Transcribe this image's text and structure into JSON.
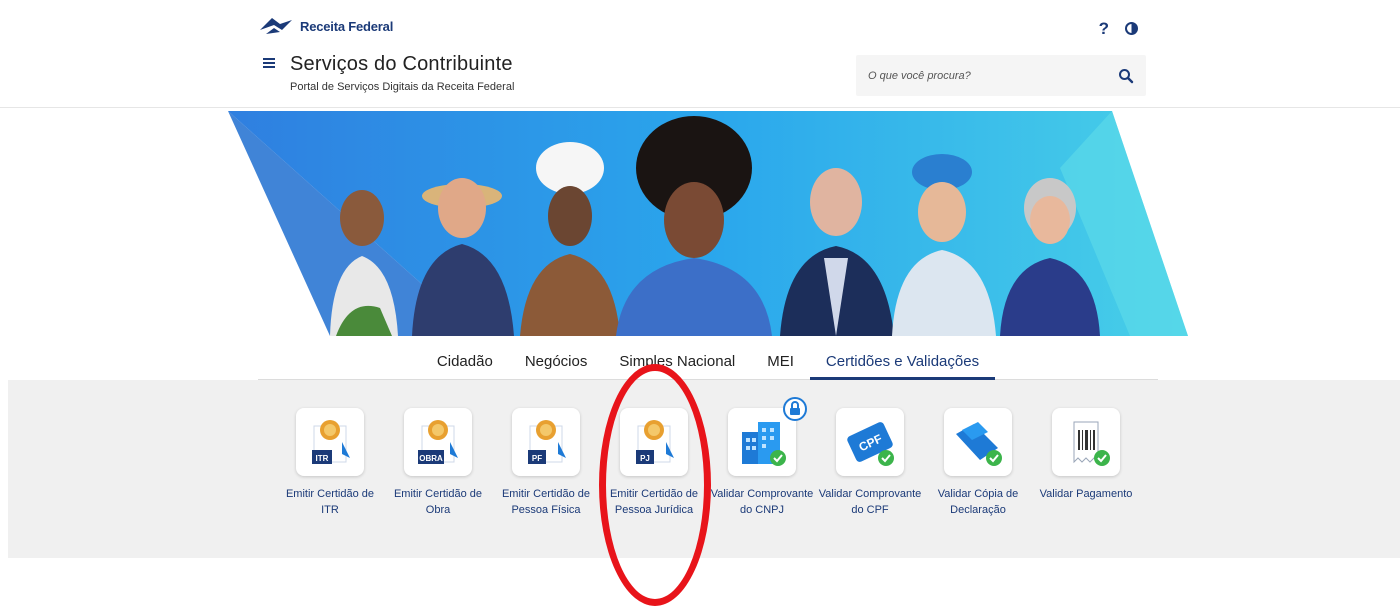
{
  "header": {
    "logo_text": "Receita Federal",
    "title": "Serviços do Contribuinte",
    "subtitle": "Portal de Serviços Digitais da Receita Federal",
    "help_label": "?",
    "search": {
      "placeholder": "O que você procura?"
    }
  },
  "tabs": [
    {
      "label": "Cidadão"
    },
    {
      "label": "Negócios"
    },
    {
      "label": "Simples Nacional"
    },
    {
      "label": "MEI"
    },
    {
      "label": "Certidões e Validações",
      "active": true
    }
  ],
  "services": [
    {
      "label": "Emitir Certidão de ITR",
      "badge": "ITR"
    },
    {
      "label": "Emitir Certidão de Obra",
      "badge": "OBRA"
    },
    {
      "label": "Emitir Certidão de Pessoa Física",
      "badge": "PF"
    },
    {
      "label": "Emitir Certidão de Pessoa Jurídica",
      "badge": "PJ",
      "highlighted": true
    },
    {
      "label": "Validar Comprovante do CNPJ",
      "locked": true
    },
    {
      "label": "Validar Comprovante do CPF",
      "badge": "CPF"
    },
    {
      "label": "Validar Cópia de Declaração"
    },
    {
      "label": "Validar Pagamento"
    }
  ],
  "colors": {
    "brand": "#1b3a78",
    "highlight": "#e8141a",
    "check": "#3cb44b",
    "banner_blue": "#29a8e8"
  }
}
